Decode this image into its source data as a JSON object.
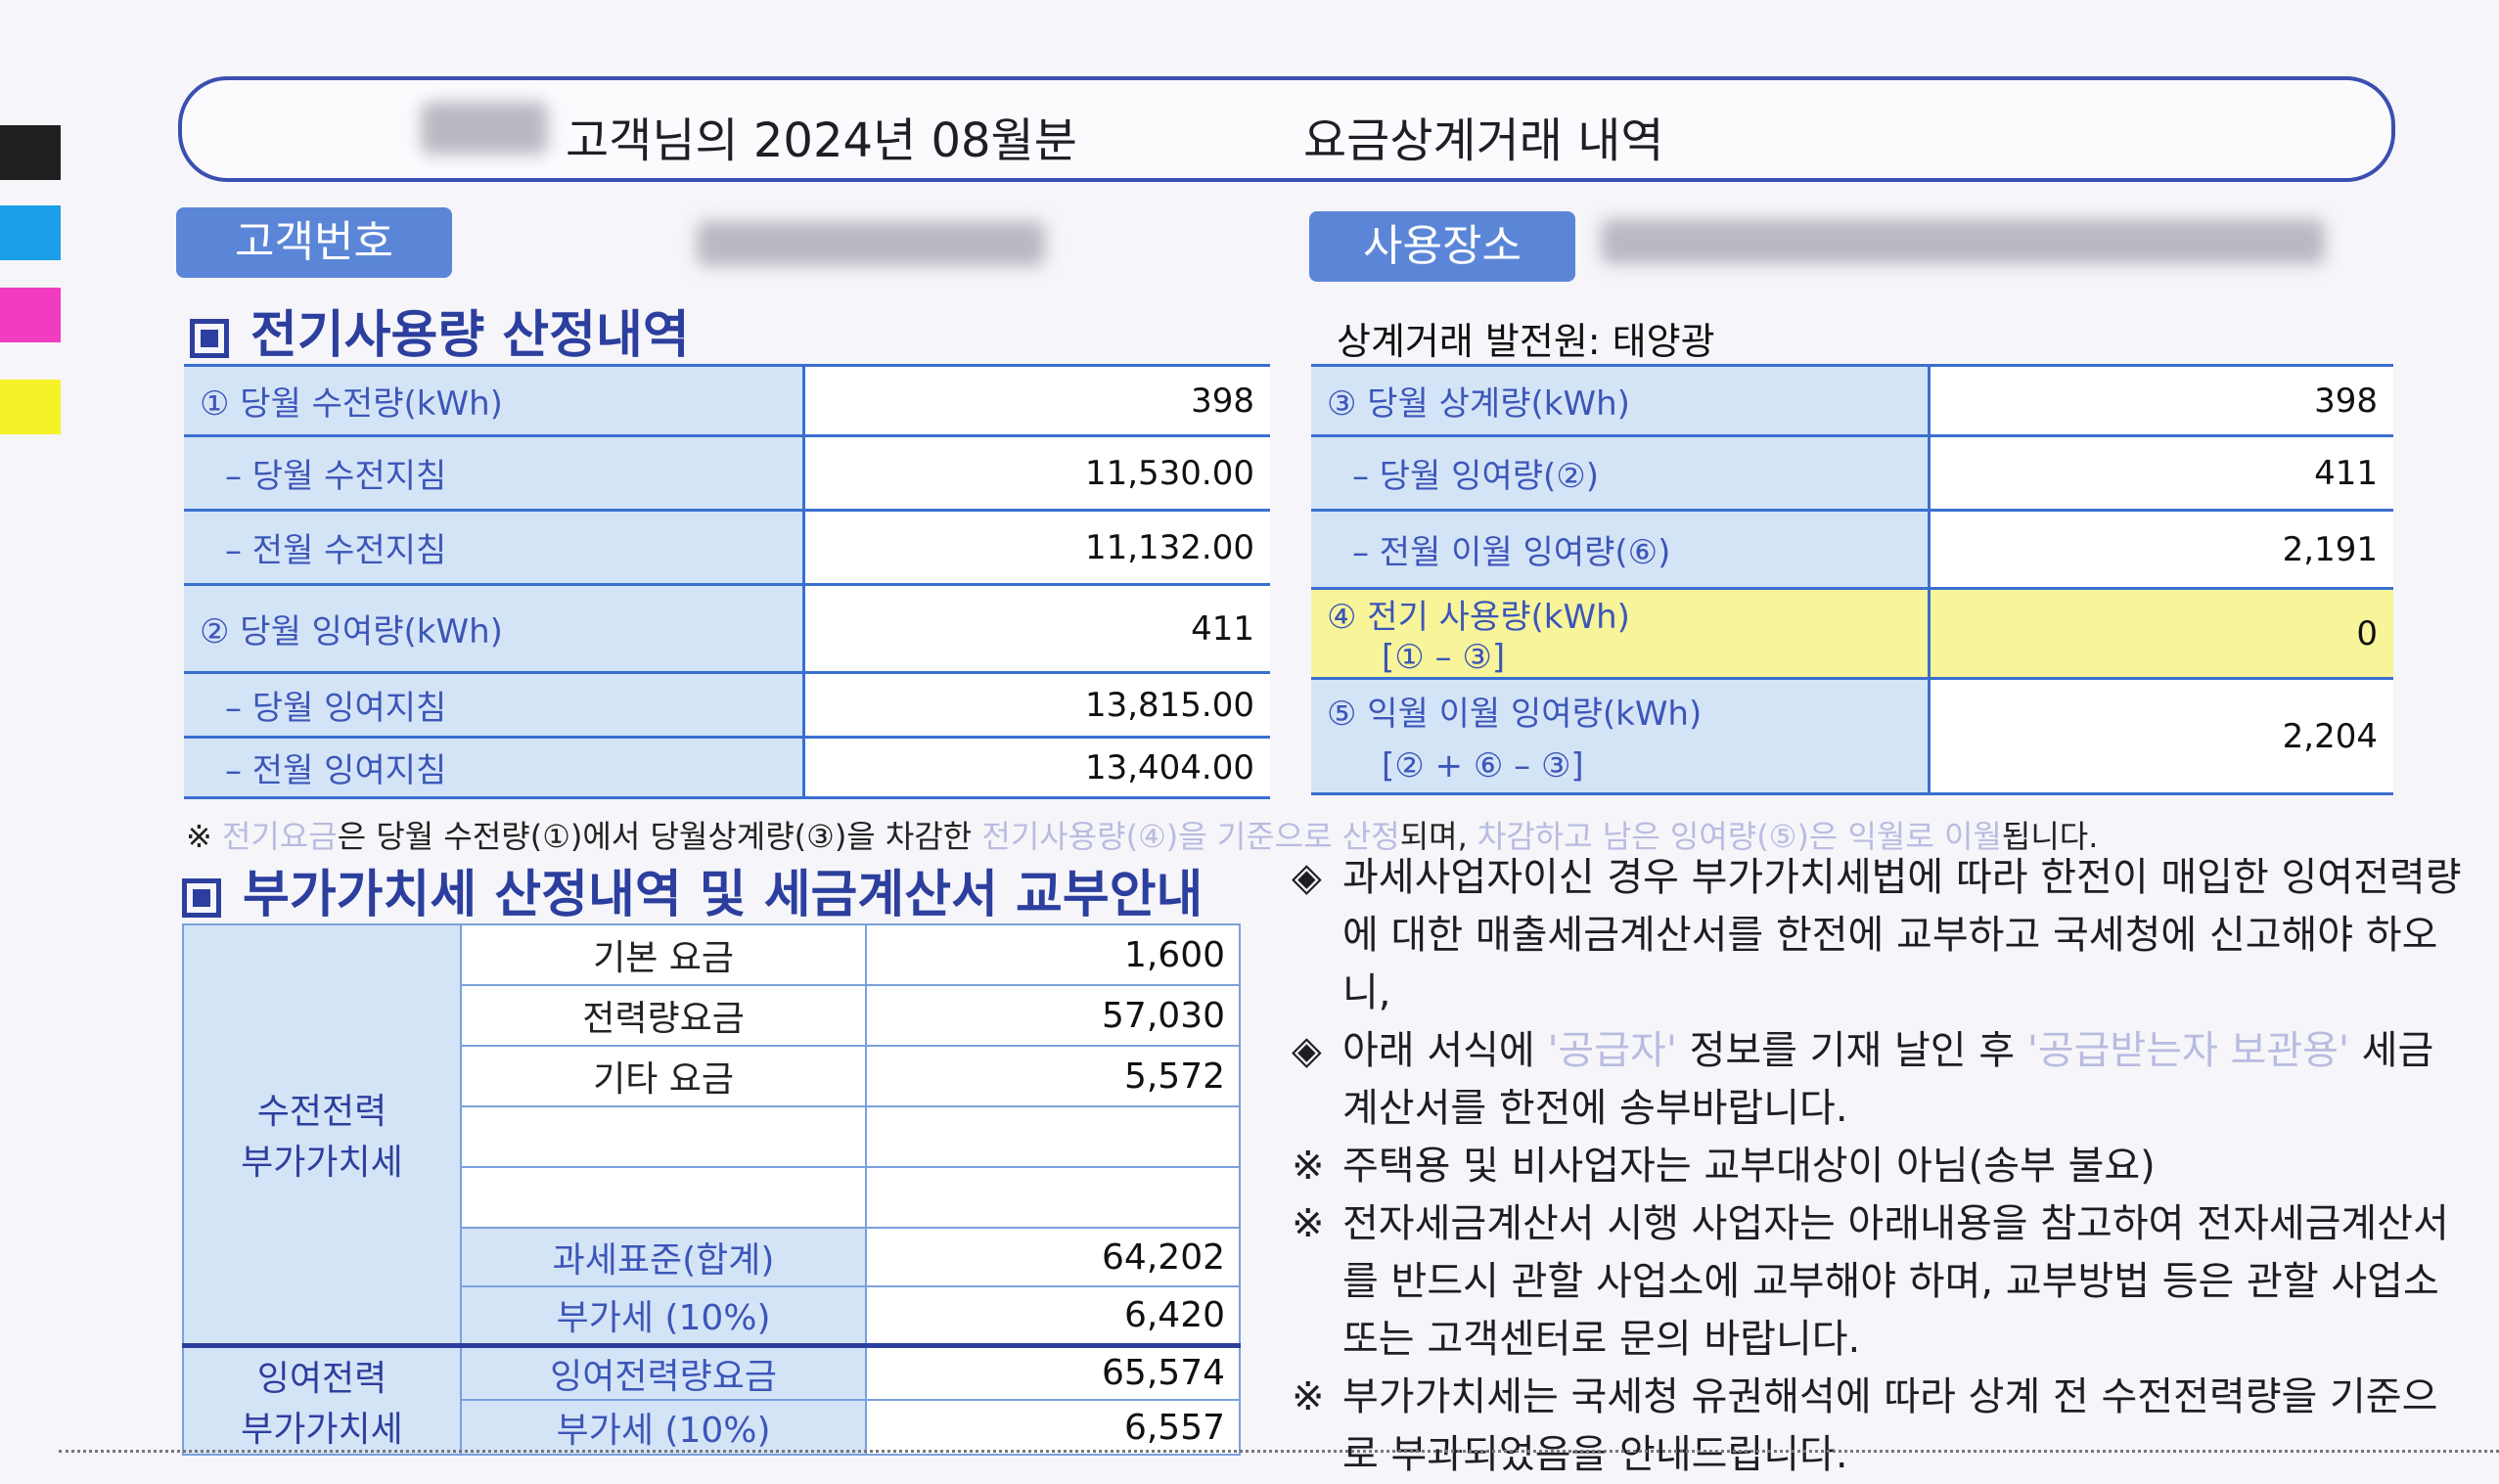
{
  "header": {
    "customer_suffix": "고객님의 2024년 08월분",
    "title": "요금상계거래 내역"
  },
  "labels": {
    "customer_number": "고객번호",
    "usage_location": "사용장소"
  },
  "colors": {
    "pill": "#5b86d8",
    "section_title": "#2c3f9e",
    "label_bg": "#d4e4f7",
    "highlight": "#f7f49a",
    "swatches": [
      "#202020",
      "#1a9fe8",
      "#f23cc0",
      "#f5f22a"
    ]
  },
  "usage": {
    "section_title": "전기사용량 산정내역",
    "rows": [
      {
        "label": "① 당월 수전량(kWh)",
        "value": "398"
      },
      {
        "label": "– 당월 수전지침",
        "value": "11,530.00"
      },
      {
        "label": "– 전월 수전지침",
        "value": "11,132.00"
      },
      {
        "label": "② 당월 잉여량(kWh)",
        "value": "411"
      },
      {
        "label": "– 당월 잉여지침",
        "value": "13,815.00"
      },
      {
        "label": "– 전월 잉여지침",
        "value": "13,404.00"
      }
    ]
  },
  "offset": {
    "plant_label": "상계거래 발전원: 태양광",
    "rows": [
      {
        "label": "③ 당월 상계량(kWh)",
        "value": "398"
      },
      {
        "label": "– 당월 잉여량(②)",
        "value": "411"
      },
      {
        "label": "– 전월 이월 잉여량(⑥)",
        "value": "2,191"
      },
      {
        "label": "④ 전기 사용량(kWh)",
        "label2": "[① – ③]",
        "value": "0"
      },
      {
        "label": "⑤ 익월 이월 잉여량(kWh)",
        "label2": "[② + ⑥ – ③]",
        "value": "2,204"
      }
    ]
  },
  "footnote": {
    "p1": "※",
    "p2": "전기요금",
    "p3": "은 당월 수전량(①)에서 당월상계량(③)을 차감한",
    "p4": "전기사용량(④)을 기준으로 산정",
    "p5": "되며,",
    "p6": "차감하고 남은 잉여량(⑤)은 익월로 이월",
    "p7": "됩니다."
  },
  "vat": {
    "section_title": "부가가치세 산정내역 및 세금계산서 교부안내",
    "group1": "수전전력\n부가가치세",
    "group2": "잉여전력\n부가가치세",
    "rows": [
      {
        "item": "기본 요금",
        "value": "1,600"
      },
      {
        "item": "전력량요금",
        "value": "57,030"
      },
      {
        "item": "기타 요금",
        "value": "5,572"
      },
      {
        "item": "",
        "value": ""
      },
      {
        "item": "",
        "value": ""
      },
      {
        "item": "과세표준(합계)",
        "value": "64,202"
      },
      {
        "item": "부가세 (10%)",
        "value": "6,420"
      },
      {
        "item": "잉여전력량요금",
        "value": "65,574"
      },
      {
        "item": "부가세 (10%)",
        "value": "6,557"
      }
    ]
  },
  "notes": [
    {
      "sym": "◈",
      "text": "과세사업자이신 경우 부가가치세법에 따라 한전이 매입한 잉여전력량에 대한 매출세금계산서를 한전에 교부하고 국세청에 신고해야 하오니,"
    },
    {
      "sym": "◈",
      "pre": "아래 서식에",
      "q1": "'공급자'",
      "mid": "정보를 기재 날인 후",
      "q2": "'공급받는자 보관용'",
      "post": "세금계산서를 한전에 송부바랍니다."
    },
    {
      "sym": "※",
      "text": "주택용 및 비사업자는 교부대상이 아님(송부 불요)"
    },
    {
      "sym": "※",
      "text": "전자세금계산서 시행 사업자는 아래내용을 참고하여 전자세금계산서를 반드시 관할 사업소에 교부해야 하며, 교부방법 등은 관할 사업소 또는 고객센터로 문의 바랍니다."
    },
    {
      "sym": "※",
      "text": "부가가치세는 국세청 유권해석에 따라 상계 전 수전전력량을 기준으로 부과되었음을 안내드립니다."
    }
  ]
}
